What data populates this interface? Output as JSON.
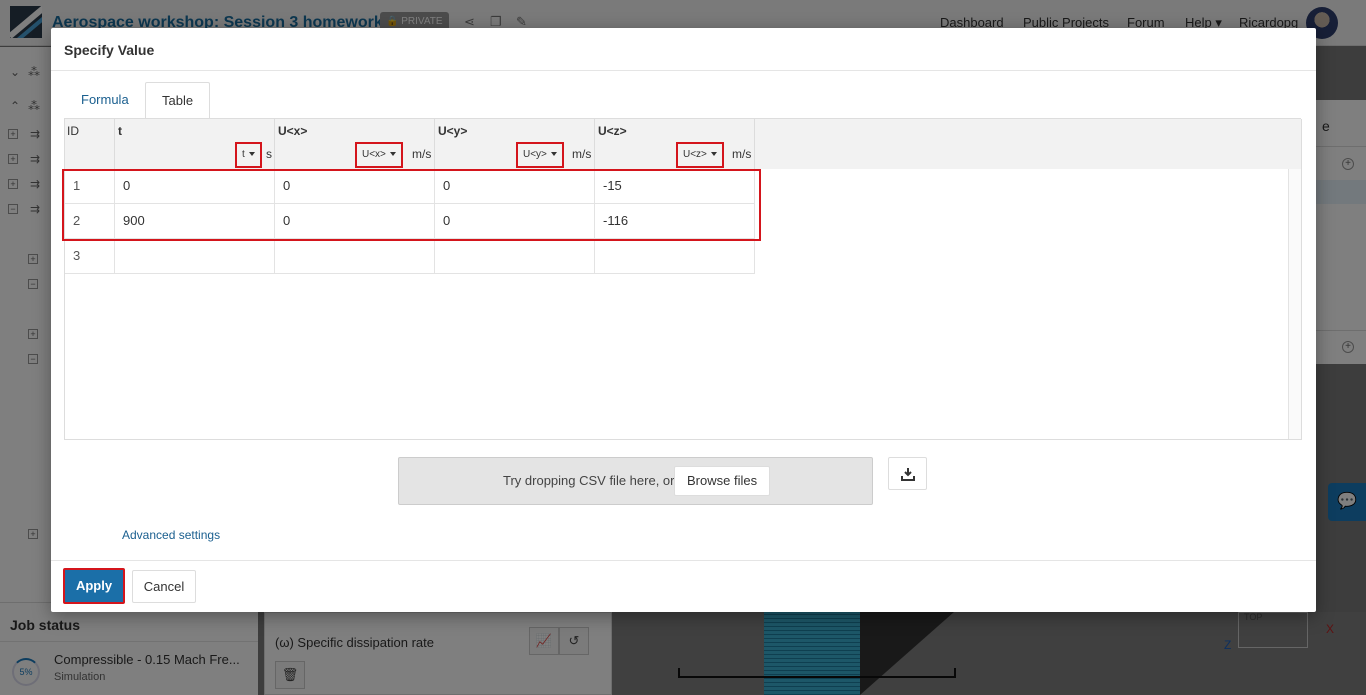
{
  "app": {
    "project_title": "Aerospace workshop: Session 3 homework",
    "private_badge": "PRIVATE",
    "nav": [
      "Dashboard",
      "Public Projects",
      "Forum",
      "Help",
      "Ricardopg"
    ],
    "help_caret": "▾"
  },
  "job_status": {
    "title": "Job status",
    "progress": "5%",
    "job_name": "Compressible - 0.15 Mach Fre...",
    "job_type": "Simulation"
  },
  "mid_panel": {
    "label": "(ω) Specific dissipation rate"
  },
  "right_panel": {
    "partial_text": "e"
  },
  "viewport": {
    "axis_x": "X",
    "axis_z": "Z",
    "axis_top": "TOP"
  },
  "modal": {
    "title": "Specify Value",
    "tabs": [
      {
        "label": "Formula",
        "active": false
      },
      {
        "label": "Table",
        "active": true
      }
    ],
    "table": {
      "columns": [
        {
          "name": "ID",
          "unit_select": "",
          "unit": ""
        },
        {
          "name": "t",
          "unit_select": "t",
          "unit": "s"
        },
        {
          "name": "U<x>",
          "unit_select": "U<x>",
          "unit": "m/s"
        },
        {
          "name": "U<y>",
          "unit_select": "U<y>",
          "unit": "m/s"
        },
        {
          "name": "U<z>",
          "unit_select": "U<z>",
          "unit": "m/s"
        }
      ],
      "rows": [
        {
          "id": "1",
          "t": "0",
          "ux": "0",
          "uy": "0",
          "uz": "-15"
        },
        {
          "id": "2",
          "t": "900",
          "ux": "0",
          "uy": "0",
          "uz": "-116"
        },
        {
          "id": "3",
          "t": "",
          "ux": "",
          "uy": "",
          "uz": ""
        }
      ]
    },
    "dropzone_text": "Try dropping CSV file here, or",
    "browse_label": "Browse files",
    "advanced_settings": "Advanced settings",
    "apply_label": "Apply",
    "cancel_label": "Cancel"
  },
  "colors": {
    "accent": "#1b6fa8",
    "highlight": "#d4151c",
    "link": "#1a5f8f"
  }
}
